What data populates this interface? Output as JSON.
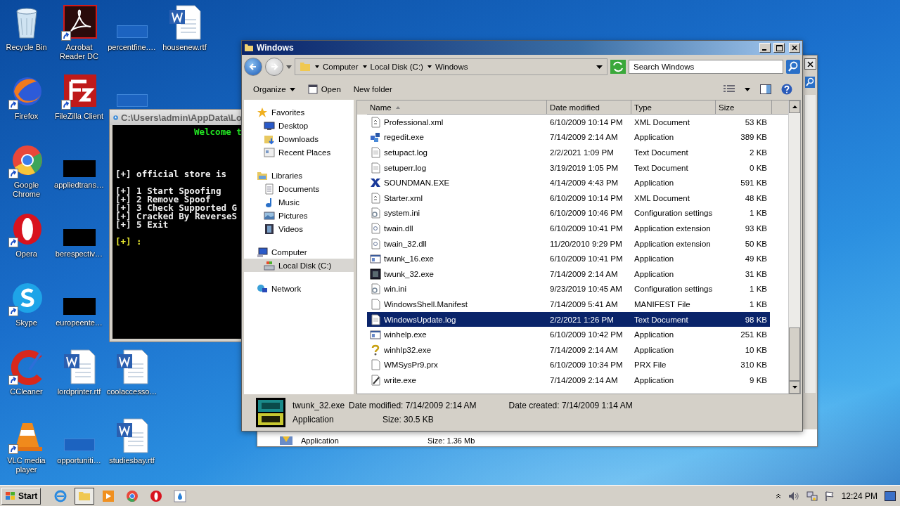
{
  "desktop": {
    "columns": [
      [
        {
          "label": "Recycle Bin",
          "kind": "recycle",
          "shortcut": false
        },
        {
          "label": "Firefox",
          "kind": "firefox",
          "shortcut": true
        },
        {
          "label": "Google Chrome",
          "kind": "chrome",
          "shortcut": true
        },
        {
          "label": "Opera",
          "kind": "opera",
          "shortcut": true
        },
        {
          "label": "Skype",
          "kind": "skype",
          "shortcut": true
        },
        {
          "label": "CCleaner",
          "kind": "ccleaner",
          "shortcut": true
        },
        {
          "label": "VLC media player",
          "kind": "vlc",
          "shortcut": true
        }
      ],
      [
        {
          "label": "Acrobat Reader DC",
          "kind": "acrobat",
          "shortcut": true
        },
        {
          "label": "FileZilla Client",
          "kind": "filezilla",
          "shortcut": true
        },
        {
          "label": "appliedtrans…",
          "kind": "black",
          "shortcut": false
        },
        {
          "label": "berespectiv…",
          "kind": "black",
          "shortcut": false
        },
        {
          "label": "europeente…",
          "kind": "black",
          "shortcut": false
        },
        {
          "label": "lordprinter.rtf",
          "kind": "word",
          "shortcut": false
        },
        {
          "label": "opportuniti…",
          "kind": "thumb",
          "shortcut": false
        }
      ],
      [
        {
          "label": "percentfine.…",
          "kind": "thumb",
          "shortcut": false
        },
        {
          "kind": "thumb",
          "shortcut": false
        },
        {
          "kind": "empty"
        },
        {
          "kind": "empty"
        },
        {
          "kind": "empty"
        },
        {
          "label": "coolaccesso…",
          "kind": "word",
          "shortcut": false
        },
        {
          "label": "studiesbay.rtf",
          "kind": "word",
          "shortcut": false
        }
      ],
      [
        {
          "label": "housenew.rtf",
          "kind": "word",
          "shortcut": false
        }
      ]
    ]
  },
  "console": {
    "title": "C:\\Users\\admin\\AppData\\Lo",
    "lines": [
      {
        "text": "Welcome t",
        "kind": "banner",
        "spaced": false
      },
      {
        "text": "[+] official store is",
        "kind": "line",
        "spaced": true
      },
      {
        "text": "[+] 1 Start Spoofing",
        "kind": "line",
        "spaced": true
      },
      {
        "text": "[+] 2 Remove Spoof",
        "kind": "line",
        "spaced": false
      },
      {
        "text": "[+] 3 Check Supported G",
        "kind": "line",
        "spaced": false
      },
      {
        "text": "[+] Cracked By ReverseS",
        "kind": "line",
        "spaced": false
      },
      {
        "text": "[+] 5 Exit",
        "kind": "line",
        "spaced": false
      },
      {
        "text": "[+] :",
        "kind": "prompt",
        "spaced": true
      }
    ]
  },
  "background_window": {
    "details": {
      "type": "Application",
      "size": "Size: 1.36 Mb"
    }
  },
  "explorer": {
    "title": "Windows",
    "breadcrumb": [
      "Computer",
      "Local Disk (C:)",
      "Windows"
    ],
    "search": {
      "placeholder": "Search Windows"
    },
    "toolbar": [
      {
        "label": "Organize",
        "kind": "menu"
      },
      {
        "label": "Open",
        "kind": "open"
      },
      {
        "label": "New folder",
        "kind": "plain"
      }
    ],
    "nav": [
      {
        "label": "Favorites",
        "kind": "star",
        "selected": false,
        "children": [
          {
            "label": "Desktop",
            "kind": "desktop",
            "selected": false
          },
          {
            "label": "Downloads",
            "kind": "downloads",
            "selected": false
          },
          {
            "label": "Recent Places",
            "kind": "recent",
            "selected": false
          }
        ]
      },
      {
        "label": "Libraries",
        "kind": "library",
        "selected": false,
        "children": [
          {
            "label": "Documents",
            "kind": "documents",
            "selected": false
          },
          {
            "label": "Music",
            "kind": "music",
            "selected": false
          },
          {
            "label": "Pictures",
            "kind": "pictures",
            "selected": false
          },
          {
            "label": "Videos",
            "kind": "videos",
            "selected": false
          }
        ]
      },
      {
        "label": "Computer",
        "kind": "computer",
        "selected": false,
        "children": [
          {
            "label": "Local Disk (C:)",
            "kind": "disk",
            "selected": true
          }
        ]
      },
      {
        "label": "Network",
        "kind": "network",
        "selected": false
      }
    ],
    "columns": [
      {
        "label": "Name",
        "sorted": true
      },
      {
        "label": "Date modified",
        "sorted": false
      },
      {
        "label": "Type",
        "sorted": false
      },
      {
        "label": "Size",
        "sorted": false
      }
    ],
    "rows": [
      {
        "name": "Professional.xml",
        "date": "6/10/2009 10:14 PM",
        "type": "XML Document",
        "size": "53 KB",
        "kind": "xml",
        "selected": false
      },
      {
        "name": "regedit.exe",
        "date": "7/14/2009 2:14 AM",
        "type": "Application",
        "size": "389 KB",
        "kind": "regedit",
        "selected": false
      },
      {
        "name": "setupact.log",
        "date": "2/2/2021 1:09 PM",
        "type": "Text Document",
        "size": "2 KB",
        "kind": "text",
        "selected": false
      },
      {
        "name": "setuperr.log",
        "date": "3/19/2019 1:05 PM",
        "type": "Text Document",
        "size": "0 KB",
        "kind": "text",
        "selected": false
      },
      {
        "name": "SOUNDMAN.EXE",
        "date": "4/14/2009 4:43 PM",
        "type": "Application",
        "size": "591 KB",
        "kind": "soundman",
        "selected": false
      },
      {
        "name": "Starter.xml",
        "date": "6/10/2009 10:14 PM",
        "type": "XML Document",
        "size": "48 KB",
        "kind": "xml",
        "selected": false
      },
      {
        "name": "system.ini",
        "date": "6/10/2009 10:46 PM",
        "type": "Configuration settings",
        "size": "1 KB",
        "kind": "config",
        "selected": false
      },
      {
        "name": "twain.dll",
        "date": "6/10/2009 10:41 PM",
        "type": "Application extension",
        "size": "93 KB",
        "kind": "dll",
        "selected": false
      },
      {
        "name": "twain_32.dll",
        "date": "11/20/2010 9:29 PM",
        "type": "Application extension",
        "size": "50 KB",
        "kind": "dll",
        "selected": false
      },
      {
        "name": "twunk_16.exe",
        "date": "6/10/2009 10:41 PM",
        "type": "Application",
        "size": "49 KB",
        "kind": "app",
        "selected": false
      },
      {
        "name": "twunk_32.exe",
        "date": "7/14/2009 2:14 AM",
        "type": "Application",
        "size": "31 KB",
        "kind": "twunk",
        "selected": false
      },
      {
        "name": "win.ini",
        "date": "9/23/2019 10:45 AM",
        "type": "Configuration settings",
        "size": "1 KB",
        "kind": "config",
        "selected": false
      },
      {
        "name": "WindowsShell.Manifest",
        "date": "7/14/2009 5:41 AM",
        "type": "MANIFEST File",
        "size": "1 KB",
        "kind": "blank",
        "selected": false
      },
      {
        "name": "WindowsUpdate.log",
        "date": "2/2/2021 1:26 PM",
        "type": "Text Document",
        "size": "98 KB",
        "kind": "text",
        "selected": true
      },
      {
        "name": "winhelp.exe",
        "date": "6/10/2009 10:42 PM",
        "type": "Application",
        "size": "251 KB",
        "kind": "app",
        "selected": false
      },
      {
        "name": "winhlp32.exe",
        "date": "7/14/2009 2:14 AM",
        "type": "Application",
        "size": "10 KB",
        "kind": "help",
        "selected": false
      },
      {
        "name": "WMSysPr9.prx",
        "date": "6/10/2009 10:34 PM",
        "type": "PRX File",
        "size": "310 KB",
        "kind": "blank",
        "selected": false
      },
      {
        "name": "write.exe",
        "date": "7/14/2009 2:14 AM",
        "type": "Application",
        "size": "9 KB",
        "kind": "write",
        "selected": false
      }
    ],
    "details": {
      "name": "twunk_32.exe",
      "type": "Application",
      "modified": "Date modified: 7/14/2009 2:14 AM",
      "created": "Date created: 7/14/2009 1:14 AM",
      "size": "Size: 30.5 KB"
    }
  },
  "taskbar": {
    "start": "Start",
    "items": [
      {
        "kind": "ie",
        "selected": false
      },
      {
        "kind": "explorer",
        "selected": true
      },
      {
        "kind": "media",
        "selected": false
      },
      {
        "kind": "chrome",
        "selected": false
      },
      {
        "kind": "opera",
        "selected": false
      },
      {
        "kind": "drop",
        "selected": false
      }
    ],
    "time": "12:24 PM"
  }
}
